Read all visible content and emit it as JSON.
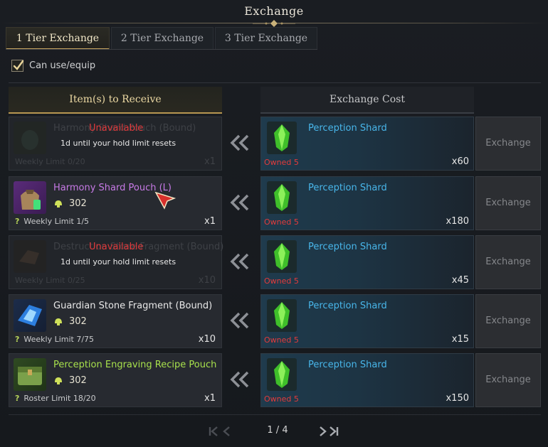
{
  "window": {
    "title": "Exchange"
  },
  "tabs": [
    {
      "label": "1 Tier Exchange",
      "active": true
    },
    {
      "label": "2 Tier Exchange",
      "active": false
    },
    {
      "label": "3 Tier Exchange",
      "active": false
    }
  ],
  "filter": {
    "label": "Can use/equip",
    "checked": true
  },
  "columns": {
    "receive": "Item(s) to Receive",
    "cost": "Exchange Cost"
  },
  "rows": [
    {
      "item": "Harmony Shard Pouch (Bound)",
      "available": false,
      "unavailable_label": "Unavailable",
      "reset_text": "1d until your hold limit resets",
      "limit": "Weekly Limit 0/20",
      "qty": "x1",
      "cost_name": "Perception Shard",
      "owned": "Owned 5",
      "cost_qty": "x60",
      "button": "Exchange"
    },
    {
      "item": "Harmony Shard Pouch (L)",
      "available": true,
      "name_color": "#c77ae6",
      "points": "302",
      "limit": "Weekly Limit 1/5",
      "qty": "x1",
      "cost_name": "Perception Shard",
      "owned": "Owned 5",
      "cost_qty": "x180",
      "button": "Exchange"
    },
    {
      "item": "Destruction Stone Fragment (Bound)",
      "available": false,
      "unavailable_label": "Unavailable",
      "reset_text": "1d until your hold limit resets",
      "limit": "Weekly Limit 0/25",
      "qty": "x10",
      "cost_name": "Perception Shard",
      "owned": "Owned 5",
      "cost_qty": "x45",
      "button": "Exchange"
    },
    {
      "item": "Guardian Stone Fragment (Bound)",
      "available": true,
      "name_color": "#e8e8e8",
      "points": "302",
      "limit": "Weekly Limit 7/75",
      "qty": "x10",
      "cost_name": "Perception Shard",
      "owned": "Owned 5",
      "cost_qty": "x15",
      "button": "Exchange"
    },
    {
      "item": "Perception Engraving Recipe Pouch",
      "available": true,
      "name_color": "#a7e04c",
      "points": "302",
      "limit": "Roster Limit 18/20",
      "qty": "x1",
      "cost_name": "Perception Shard",
      "owned": "Owned 5",
      "cost_qty": "x150",
      "button": "Exchange"
    }
  ],
  "pagination": {
    "current": "1 / 4"
  },
  "colors": {
    "accent_gold": "#c9a761",
    "cost_name": "#48b6ea",
    "owned_red": "#e33b3b",
    "unavailable_red": "#e0393b"
  }
}
